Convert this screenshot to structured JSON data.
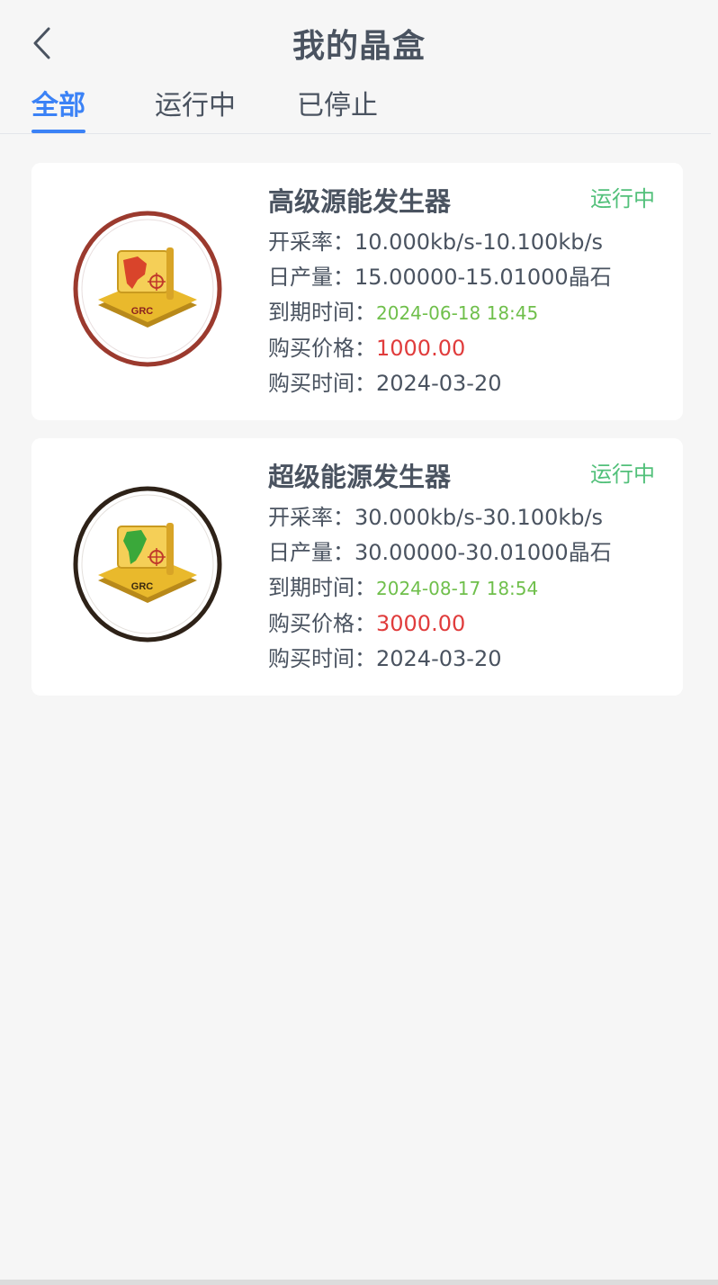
{
  "header": {
    "title": "我的晶盒",
    "back_icon": "chevron-left-icon"
  },
  "tabs": [
    {
      "label": "全部",
      "active": true
    },
    {
      "label": "运行中",
      "active": false
    },
    {
      "label": "已停止",
      "active": false
    }
  ],
  "colors": {
    "accent": "#3b82f6",
    "status_green": "#52c07a",
    "expire_green": "#6fbf4b",
    "price_red": "#e03c3c",
    "text": "#4a5360"
  },
  "cards": [
    {
      "name": "高级源能发生器",
      "status": "运行中",
      "image_text": "GRC",
      "image_icon": "grc-map-badge-north-america",
      "ring_color": "#9b3a2e",
      "rate_label": "开采率：",
      "rate_value": "10.000kb/s-10.100kb/s",
      "daily_label": "日产量：",
      "daily_value": "15.00000-15.01000晶石",
      "expire_label": "到期时间：",
      "expire_value": "2024-06-18 18:45",
      "price_label": "购买价格：",
      "price_value": "1000.00",
      "buy_label": "购买时间：",
      "buy_value": "2024-03-20"
    },
    {
      "name": "超级能源发生器",
      "status": "运行中",
      "image_text": "GRC",
      "image_icon": "grc-map-badge-south-america",
      "ring_color": "#2e2218",
      "rate_label": "开采率：",
      "rate_value": "30.000kb/s-30.100kb/s",
      "daily_label": "日产量：",
      "daily_value": "30.00000-30.01000晶石",
      "expire_label": "到期时间：",
      "expire_value": "2024-08-17 18:54",
      "price_label": "购买价格：",
      "price_value": "3000.00",
      "buy_label": "购买时间：",
      "buy_value": "2024-03-20"
    }
  ]
}
